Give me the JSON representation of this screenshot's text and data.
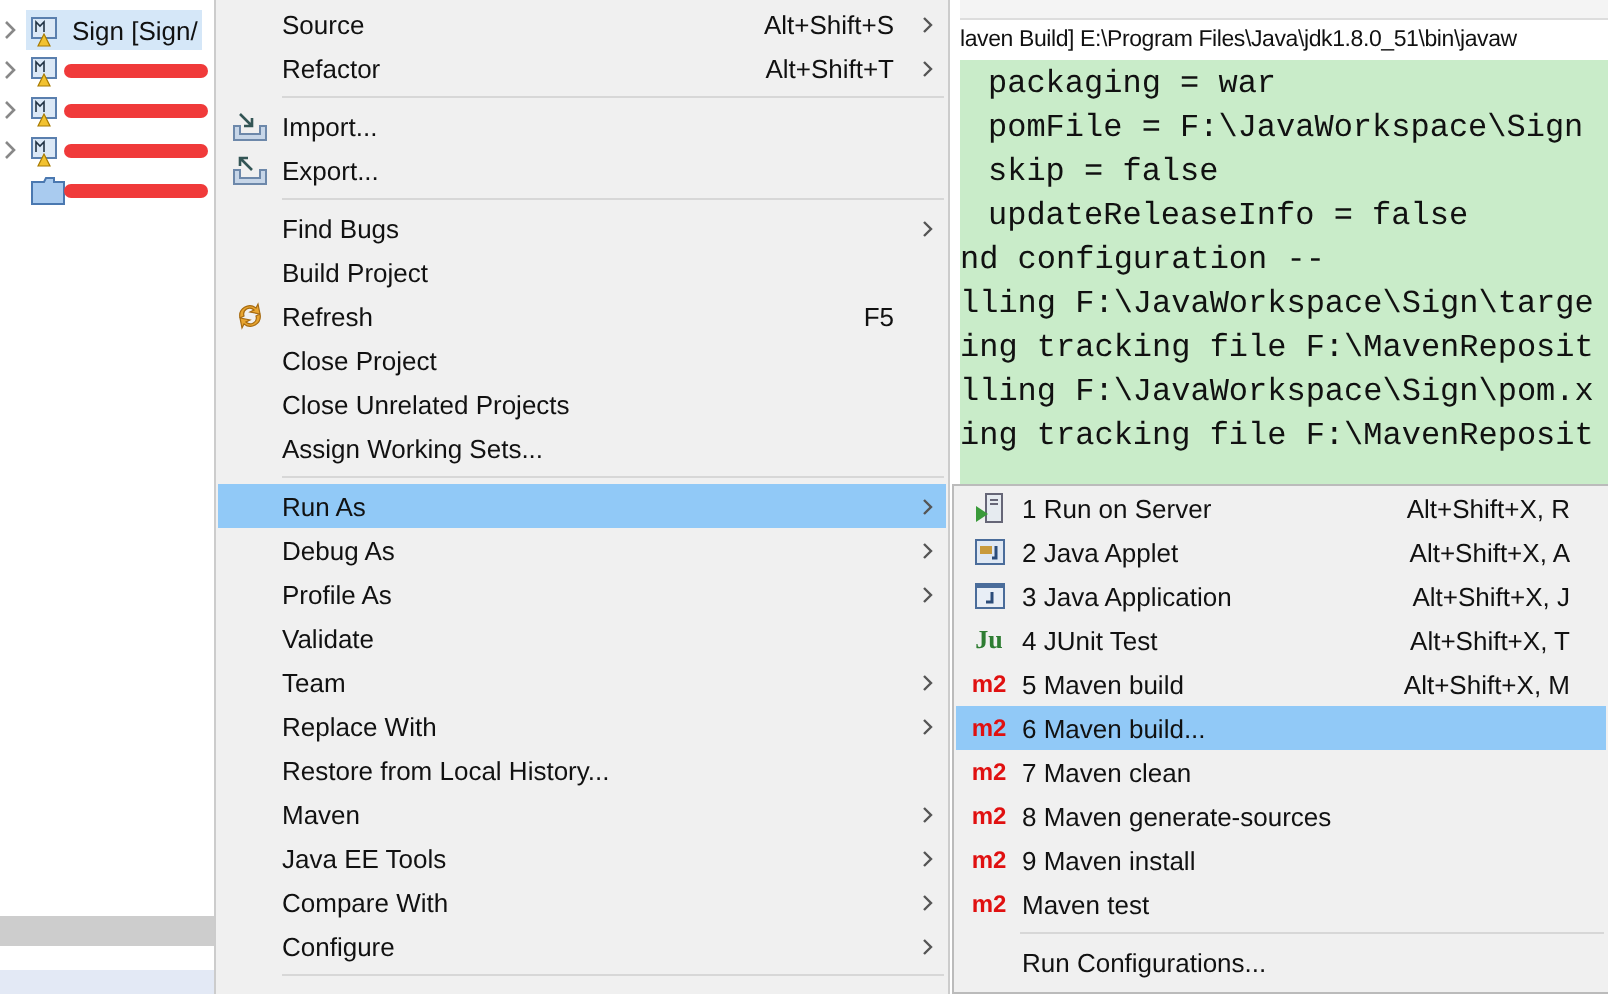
{
  "project_tree": {
    "items": [
      {
        "label": "Sign [Sign/",
        "kind": "project",
        "expandable": true,
        "selected": true,
        "redacted": false
      },
      {
        "kind": "project",
        "expandable": true,
        "selected": false,
        "redacted": true
      },
      {
        "kind": "project",
        "expandable": true,
        "selected": false,
        "redacted": true
      },
      {
        "kind": "project",
        "expandable": true,
        "selected": false,
        "redacted": true
      },
      {
        "kind": "folder",
        "expandable": false,
        "selected": false,
        "redacted": true
      }
    ]
  },
  "console": {
    "header": "laven Build] E:\\Program Files\\Java\\jdk1.8.0_51\\bin\\javaw",
    "lines": [
      {
        "kind": "param",
        "text": "packaging = war"
      },
      {
        "kind": "param",
        "text": "pomFile = F:\\JavaWorkspace\\Sign"
      },
      {
        "kind": "param",
        "text": "skip = false"
      },
      {
        "kind": "param",
        "text": "updateReleaseInfo = false"
      },
      {
        "kind": "log",
        "text": "nd configuration --"
      },
      {
        "kind": "log",
        "text": "lling F:\\JavaWorkspace\\Sign\\targe"
      },
      {
        "kind": "log",
        "text": "ing tracking file F:\\MavenReposit"
      },
      {
        "kind": "log",
        "text": "lling F:\\JavaWorkspace\\Sign\\pom.x"
      },
      {
        "kind": "log",
        "text": "ing tracking file F:\\MavenReposit"
      }
    ]
  },
  "context_menu": {
    "items": [
      {
        "kind": "item",
        "label": "Source",
        "shortcut": "Alt+Shift+S",
        "submenu": true,
        "selected": false
      },
      {
        "kind": "item",
        "label": "Refactor",
        "shortcut": "Alt+Shift+T",
        "submenu": true,
        "selected": false
      },
      {
        "kind": "separator"
      },
      {
        "kind": "import",
        "label": "Import...",
        "submenu": false,
        "selected": false
      },
      {
        "kind": "export",
        "label": "Export...",
        "submenu": false,
        "selected": false
      },
      {
        "kind": "separator"
      },
      {
        "kind": "item",
        "label": "Find Bugs",
        "submenu": true,
        "selected": false
      },
      {
        "kind": "item",
        "label": "Build Project",
        "submenu": false,
        "selected": false
      },
      {
        "kind": "refresh",
        "label": "Refresh",
        "shortcut": "F5",
        "submenu": false,
        "selected": false
      },
      {
        "kind": "item",
        "label": "Close Project",
        "submenu": false,
        "selected": false
      },
      {
        "kind": "item",
        "label": "Close Unrelated Projects",
        "submenu": false,
        "selected": false
      },
      {
        "kind": "item",
        "label": "Assign Working Sets...",
        "submenu": false,
        "selected": false
      },
      {
        "kind": "separator"
      },
      {
        "kind": "item",
        "label": "Run As",
        "submenu": true,
        "selected": true
      },
      {
        "kind": "item",
        "label": "Debug As",
        "submenu": true,
        "selected": false
      },
      {
        "kind": "item",
        "label": "Profile As",
        "submenu": true,
        "selected": false
      },
      {
        "kind": "item",
        "label": "Validate",
        "submenu": false,
        "selected": false
      },
      {
        "kind": "item",
        "label": "Team",
        "submenu": true,
        "selected": false
      },
      {
        "kind": "item",
        "label": "Replace With",
        "submenu": true,
        "selected": false
      },
      {
        "kind": "item",
        "label": "Restore from Local History...",
        "submenu": false,
        "selected": false
      },
      {
        "kind": "item",
        "label": "Maven",
        "submenu": true,
        "selected": false
      },
      {
        "kind": "item",
        "label": "Java EE Tools",
        "submenu": true,
        "selected": false
      },
      {
        "kind": "item",
        "label": "Compare With",
        "submenu": true,
        "selected": false
      },
      {
        "kind": "item",
        "label": "Configure",
        "submenu": true,
        "selected": false
      },
      {
        "kind": "separator"
      }
    ]
  },
  "run_as_submenu": {
    "items": [
      {
        "kind": "server",
        "label": "1 Run on Server",
        "shortcut": "Alt+Shift+X, R",
        "selected": false
      },
      {
        "kind": "applet",
        "label": "2 Java Applet",
        "shortcut": "Alt+Shift+X, A",
        "selected": false
      },
      {
        "kind": "java",
        "label": "3 Java Application",
        "shortcut": "Alt+Shift+X, J",
        "selected": false
      },
      {
        "kind": "junit",
        "label": "4 JUnit Test",
        "icon_text": "Ju",
        "shortcut": "Alt+Shift+X, T",
        "selected": false
      },
      {
        "kind": "maven",
        "label": "5 Maven build",
        "icon_text": "m2",
        "shortcut": "Alt+Shift+X, M",
        "selected": false
      },
      {
        "kind": "maven",
        "label": "6 Maven build...",
        "icon_text": "m2",
        "selected": true
      },
      {
        "kind": "maven",
        "label": "7 Maven clean",
        "icon_text": "m2",
        "selected": false
      },
      {
        "kind": "maven",
        "label": "8 Maven generate-sources",
        "icon_text": "m2",
        "selected": false
      },
      {
        "kind": "maven",
        "label": "9 Maven install",
        "icon_text": "m2",
        "selected": false
      },
      {
        "kind": "maven",
        "label": "Maven test",
        "icon_text": "m2",
        "selected": false
      },
      {
        "kind": "separator"
      },
      {
        "kind": "item",
        "label": "Run Configurations...",
        "selected": false
      }
    ]
  }
}
